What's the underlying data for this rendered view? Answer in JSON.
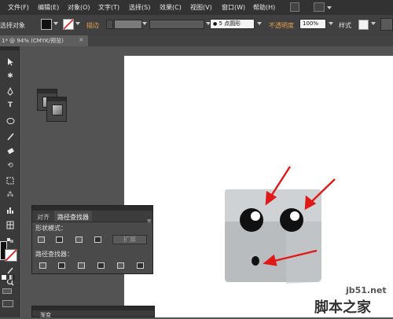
{
  "menu": {
    "items": [
      "文件(F)",
      "编辑(E)",
      "对象(O)",
      "文字(T)",
      "选择(S)",
      "效果(C)",
      "视图(V)",
      "窗口(W)",
      "帮助(H)"
    ]
  },
  "control_bar": {
    "selection_label": "选择对象",
    "stroke_label": "描边",
    "brush_value": "5 点圆形",
    "opacity_label": "不透明度",
    "opacity_value": "100%",
    "style_label": "样式"
  },
  "document": {
    "tab_title": "1* @ 94% (CMYK/预览)"
  },
  "pathfinder_panel": {
    "tabs": [
      "对齐",
      "路径查找器"
    ],
    "menu_glyph": "≡",
    "shape_modes_label": "形状模式：",
    "pathfinders_label": "路径查找器：",
    "expand_button": "扩展"
  },
  "bottom_panel": {
    "title": "渐变"
  },
  "colors": {
    "accent_orange": "#e8a050",
    "arrow_red": "#e01818",
    "character_gray": "#b9bcbe",
    "character_top": "#cfd2d4"
  },
  "watermark": {
    "url": "jb51.net",
    "text": "脚本之家"
  }
}
